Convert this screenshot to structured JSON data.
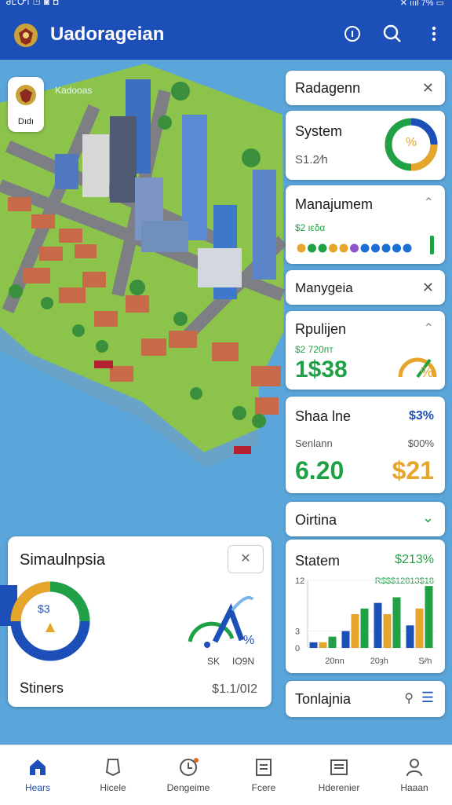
{
  "status_bar": {
    "left": "ᏧᏝᏅᎥ  ◳  ◙  ◘",
    "right": "✕ ıııl  7%  ▭"
  },
  "app": {
    "title": "Uadoragеian"
  },
  "map": {
    "badge_label": "Dıdı",
    "caption": "Kadooas"
  },
  "panel": {
    "card1": {
      "title": "Radagenn"
    },
    "card2": {
      "title": "System",
      "donut_label": "%",
      "value": "S1.2⁄h"
    },
    "card3": {
      "title": "Manajumem",
      "subtitle": "$2 ιεδα",
      "dot_colors": [
        "#e6a52b",
        "#20a145",
        "#20a145",
        "#e6a52b",
        "#e6a52b",
        "#8e55c9",
        "#1d6fd8",
        "#1d6fd8",
        "#1d6fd8",
        "#1d6fd8",
        "#1d6fd8"
      ]
    },
    "card4": {
      "title": "Manygeia"
    },
    "card5": {
      "title": "Rpulijen",
      "subtitle": "$2 720пт",
      "value": "1$38",
      "gauge_label": "%"
    },
    "card6": {
      "title": "Shaa lne",
      "badge": "$3%",
      "left_label": "Senlann",
      "right_label": "$00%",
      "left_value": "6.20",
      "right_value": "$21"
    },
    "card7": {
      "title": "Oirtina"
    },
    "card8": {
      "title": "Statem",
      "badge": "$213%",
      "subtitle": "R$$$12813$18"
    },
    "card9": {
      "title": "Tonlajnia"
    }
  },
  "chart_data": {
    "type": "bar",
    "categories": [
      "20nn",
      "20ȝh",
      "S⁄⁄n"
    ],
    "ytick_labels": [
      "12",
      "3",
      "0"
    ],
    "series": [
      {
        "values": [
          1,
          3,
          8,
          4
        ]
      },
      {
        "values": [
          1,
          6,
          6,
          7
        ]
      },
      {
        "values": [
          2,
          7,
          9,
          11
        ]
      }
    ],
    "ylim": [
      0,
      12
    ],
    "colors": [
      "#1d4fb8",
      "#e6a52b",
      "#20a145"
    ]
  },
  "sim_card": {
    "title": "Simaulnpsia",
    "donut_label": "$3",
    "gauge_label": "%",
    "gauge_caption_left": "SK",
    "gauge_caption_right": "IO9N",
    "footer_left": "Stiners",
    "footer_right": "$1.1/0I2"
  },
  "nav": [
    {
      "label": "Hears"
    },
    {
      "label": "Hicele"
    },
    {
      "label": "Dengeime"
    },
    {
      "label": "Fcere"
    },
    {
      "label": "Hderenier"
    },
    {
      "label": "Haaan"
    }
  ]
}
